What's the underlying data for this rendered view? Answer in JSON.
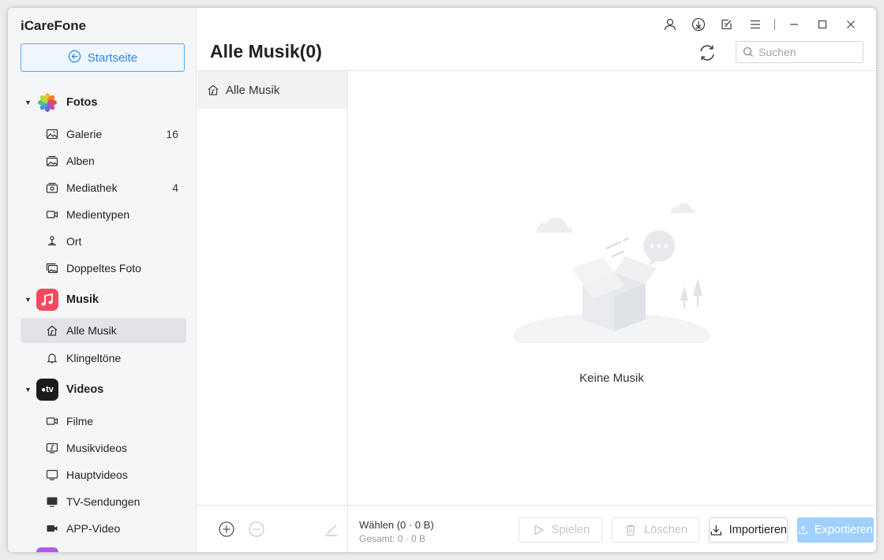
{
  "app": {
    "title": "iCareFone"
  },
  "home_button": {
    "label": "Startseite"
  },
  "sidebar": {
    "categories": [
      {
        "label": "Fotos",
        "items": [
          {
            "label": "Galerie",
            "count": "16"
          },
          {
            "label": "Alben",
            "count": ""
          },
          {
            "label": "Mediathek",
            "count": "4"
          },
          {
            "label": "Medientypen",
            "count": ""
          },
          {
            "label": "Ort",
            "count": ""
          },
          {
            "label": "Doppeltes Foto",
            "count": ""
          }
        ]
      },
      {
        "label": "Musik",
        "items": [
          {
            "label": "Alle Musik",
            "count": ""
          },
          {
            "label": "Klingeltöne",
            "count": ""
          }
        ]
      },
      {
        "label": "Videos",
        "items": [
          {
            "label": "Filme",
            "count": ""
          },
          {
            "label": "Musikvideos",
            "count": ""
          },
          {
            "label": "Hauptvideos",
            "count": ""
          },
          {
            "label": "TV-Sendungen",
            "count": ""
          },
          {
            "label": "APP-Video",
            "count": ""
          }
        ]
      }
    ],
    "videos_icon_text": "tv"
  },
  "header": {
    "page_title": "Alle Musik(0)",
    "search_placeholder": "Suchen"
  },
  "subpanel": {
    "item_label": "Alle Musik"
  },
  "empty": {
    "message": "Keine Musik"
  },
  "footer": {
    "selection": "Wählen (0 · 0 B)",
    "total": "Gesamt: 0 · 0 B",
    "play_label": "Spielen",
    "delete_label": "Löschen",
    "import_label": "Importieren",
    "export_label": "Exportieren"
  },
  "colors": {
    "accent": "#2f86e0",
    "musik_icon": "#f04b5f",
    "videos_icon": "#1b1b1b",
    "export_button": "#9fd0ff"
  }
}
